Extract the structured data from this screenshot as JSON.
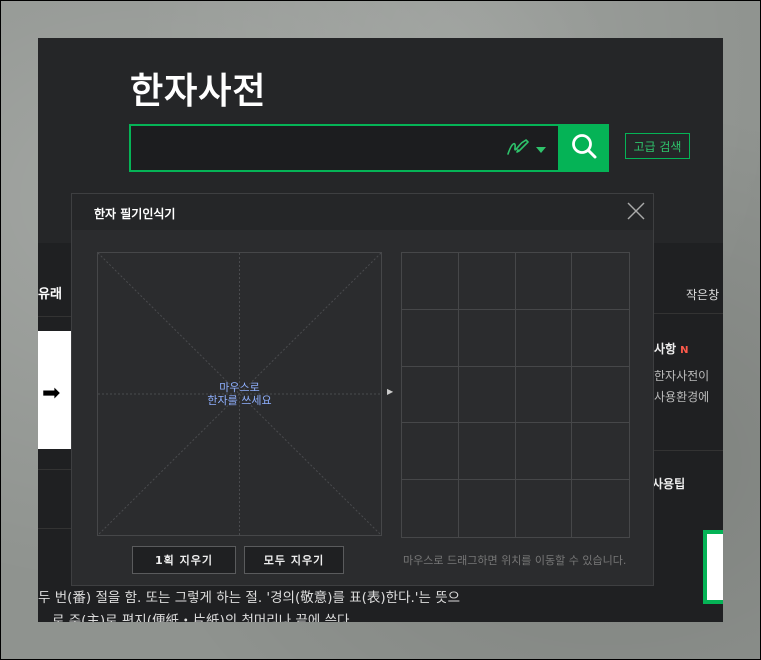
{
  "app": {
    "title": "한자사전",
    "advanced_search_label": "고급 검색",
    "search_placeholder": ""
  },
  "background": {
    "left_tab": "유래",
    "small_window_label": "작은창",
    "notice_title": "사항",
    "notice_badge": "N",
    "notice_lines": [
      "한자사전이",
      "사용환경에"
    ],
    "tip_title": "사용팁",
    "body_lines": [
      "두 번(番) 절을 함. 또는 그렇게 하는 절. '경의(敬意)를 표(表)한다.'는 뜻으",
      "로 주(主)로 편지(便紙・片紙)의 첫머리나 끝에 쓴다."
    ]
  },
  "dialog": {
    "title": "한자 필기인식기",
    "canvas_hint_line1": "마우스로",
    "canvas_hint_line2": "한자를 쓰세요",
    "clear_one_label": "1획 지우기",
    "clear_all_label": "모두 지우기",
    "drag_hint": "마우스로 드래그하면 위치를 이동할 수 있습니다."
  },
  "colors": {
    "accent": "#05b356",
    "background": "#1f2022",
    "dialog_bg": "#2b2c2e",
    "badge": "#ff5a4b",
    "hint_text": "#8fb0ff"
  },
  "icons": [
    "handwriting-icon",
    "chevron-down-icon",
    "search-icon",
    "close-icon",
    "arrow-right-icon",
    "pager-arrow-icon"
  ]
}
